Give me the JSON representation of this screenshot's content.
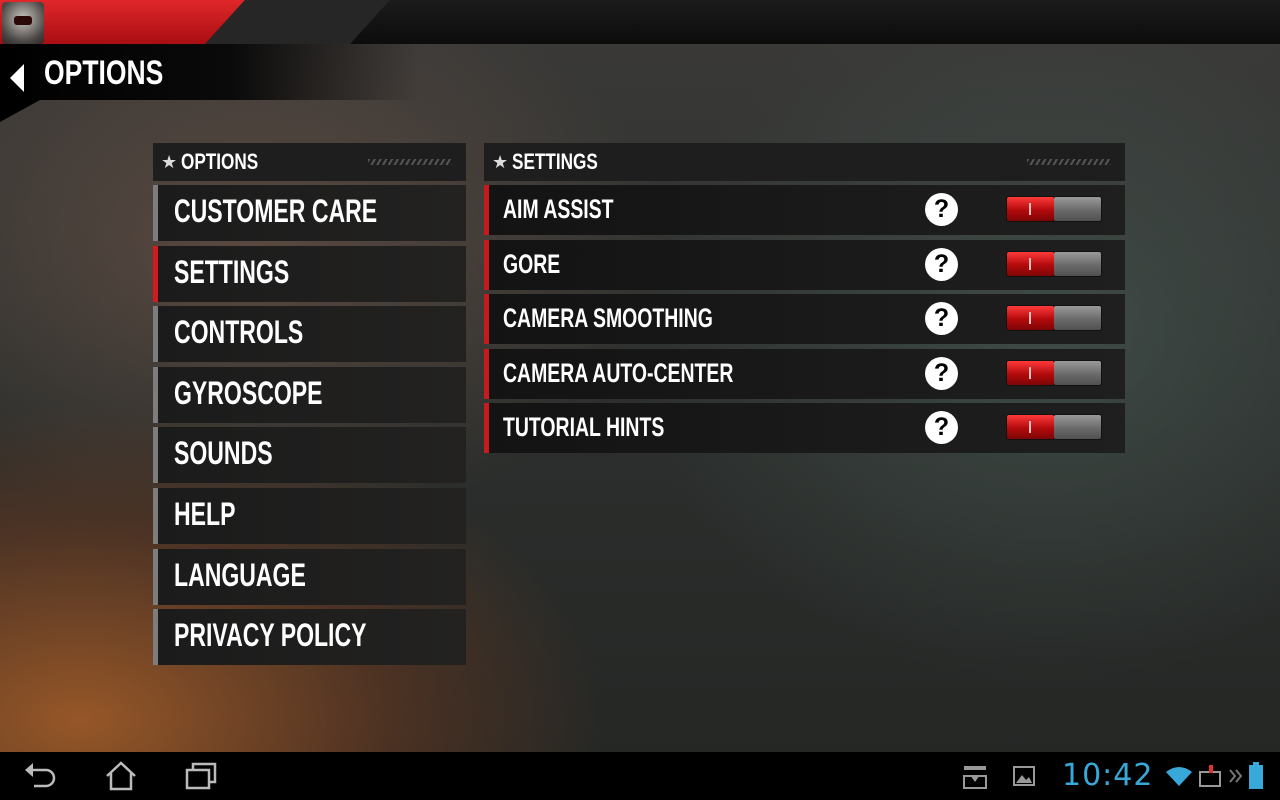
{
  "header": {
    "title": "OPTIONS"
  },
  "left_panel": {
    "heading": "OPTIONS",
    "items": [
      {
        "label": "CUSTOMER CARE",
        "active": false
      },
      {
        "label": "SETTINGS",
        "active": true
      },
      {
        "label": "CONTROLS",
        "active": false
      },
      {
        "label": "GYROSCOPE",
        "active": false
      },
      {
        "label": "SOUNDS",
        "active": false
      },
      {
        "label": "HELP",
        "active": false
      },
      {
        "label": "LANGUAGE",
        "active": false
      },
      {
        "label": "PRIVACY POLICY",
        "active": false
      }
    ]
  },
  "right_panel": {
    "heading": "SETTINGS",
    "rows": [
      {
        "label": "AIM ASSIST",
        "help": "?",
        "enabled": true
      },
      {
        "label": "GORE",
        "help": "?",
        "enabled": true
      },
      {
        "label": "CAMERA SMOOTHING",
        "help": "?",
        "enabled": true
      },
      {
        "label": "CAMERA AUTO-CENTER",
        "help": "?",
        "enabled": true
      },
      {
        "label": "TUTORIAL HINTS",
        "help": "?",
        "enabled": true
      }
    ]
  },
  "status_bar": {
    "time": "10:42"
  },
  "icons": {
    "back": "chevron-left-icon",
    "star": "star-icon",
    "help": "question-icon",
    "nav": [
      "back-icon",
      "home-icon",
      "recent-apps-icon"
    ],
    "status": [
      "download-icon",
      "image-icon",
      "wifi-icon",
      "keyboard-icon",
      "more-icon",
      "battery-icon"
    ]
  },
  "colors": {
    "accent": "#d01b1f",
    "clock": "#38a8d8",
    "toggle_on": "#c8141a",
    "toggle_off": "#7a7a7a"
  }
}
